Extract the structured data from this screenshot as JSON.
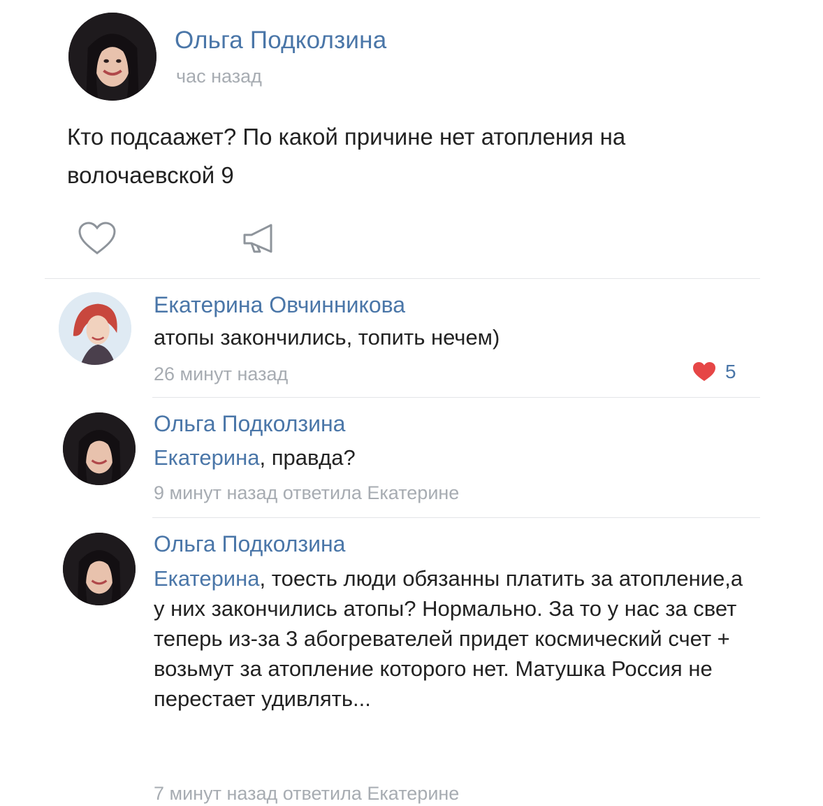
{
  "post": {
    "author": "Ольга Подколзина",
    "time": "час назад",
    "text": "Кто подсаажет? По какой причине нет атопления на волочаевской 9",
    "like_icon": "heart-outline-icon",
    "share_icon": "megaphone-icon"
  },
  "comments": [
    {
      "author": "Екатерина Овчинникова",
      "mention": "",
      "text": "атопы закончились, топить нечем)",
      "meta": "26 минут назад",
      "likes": "5",
      "likes_icon": "heart-filled-icon",
      "likes_color": "#e64646"
    },
    {
      "author": "Ольга Подколзина",
      "mention": "Екатерина",
      "text": ", правда?",
      "meta": "9 минут назад ответила Екатерине"
    },
    {
      "author": "Ольга Подколзина",
      "mention": "Екатерина",
      "text": ", тоесть люди обязанны платить за атопление,а у них закончились атопы? Нормально. За то у нас за свет теперь из-за 3 абогревателей придет космический счет + возьмут за атопление которого нет. Матушка Россия не перестает удивлять...",
      "meta": "7 минут назад ответила Екатерине"
    }
  ],
  "colors": {
    "link": "#4a76a8",
    "muted": "#a7acb2",
    "text": "#222222",
    "divider": "#e3e5e8"
  }
}
